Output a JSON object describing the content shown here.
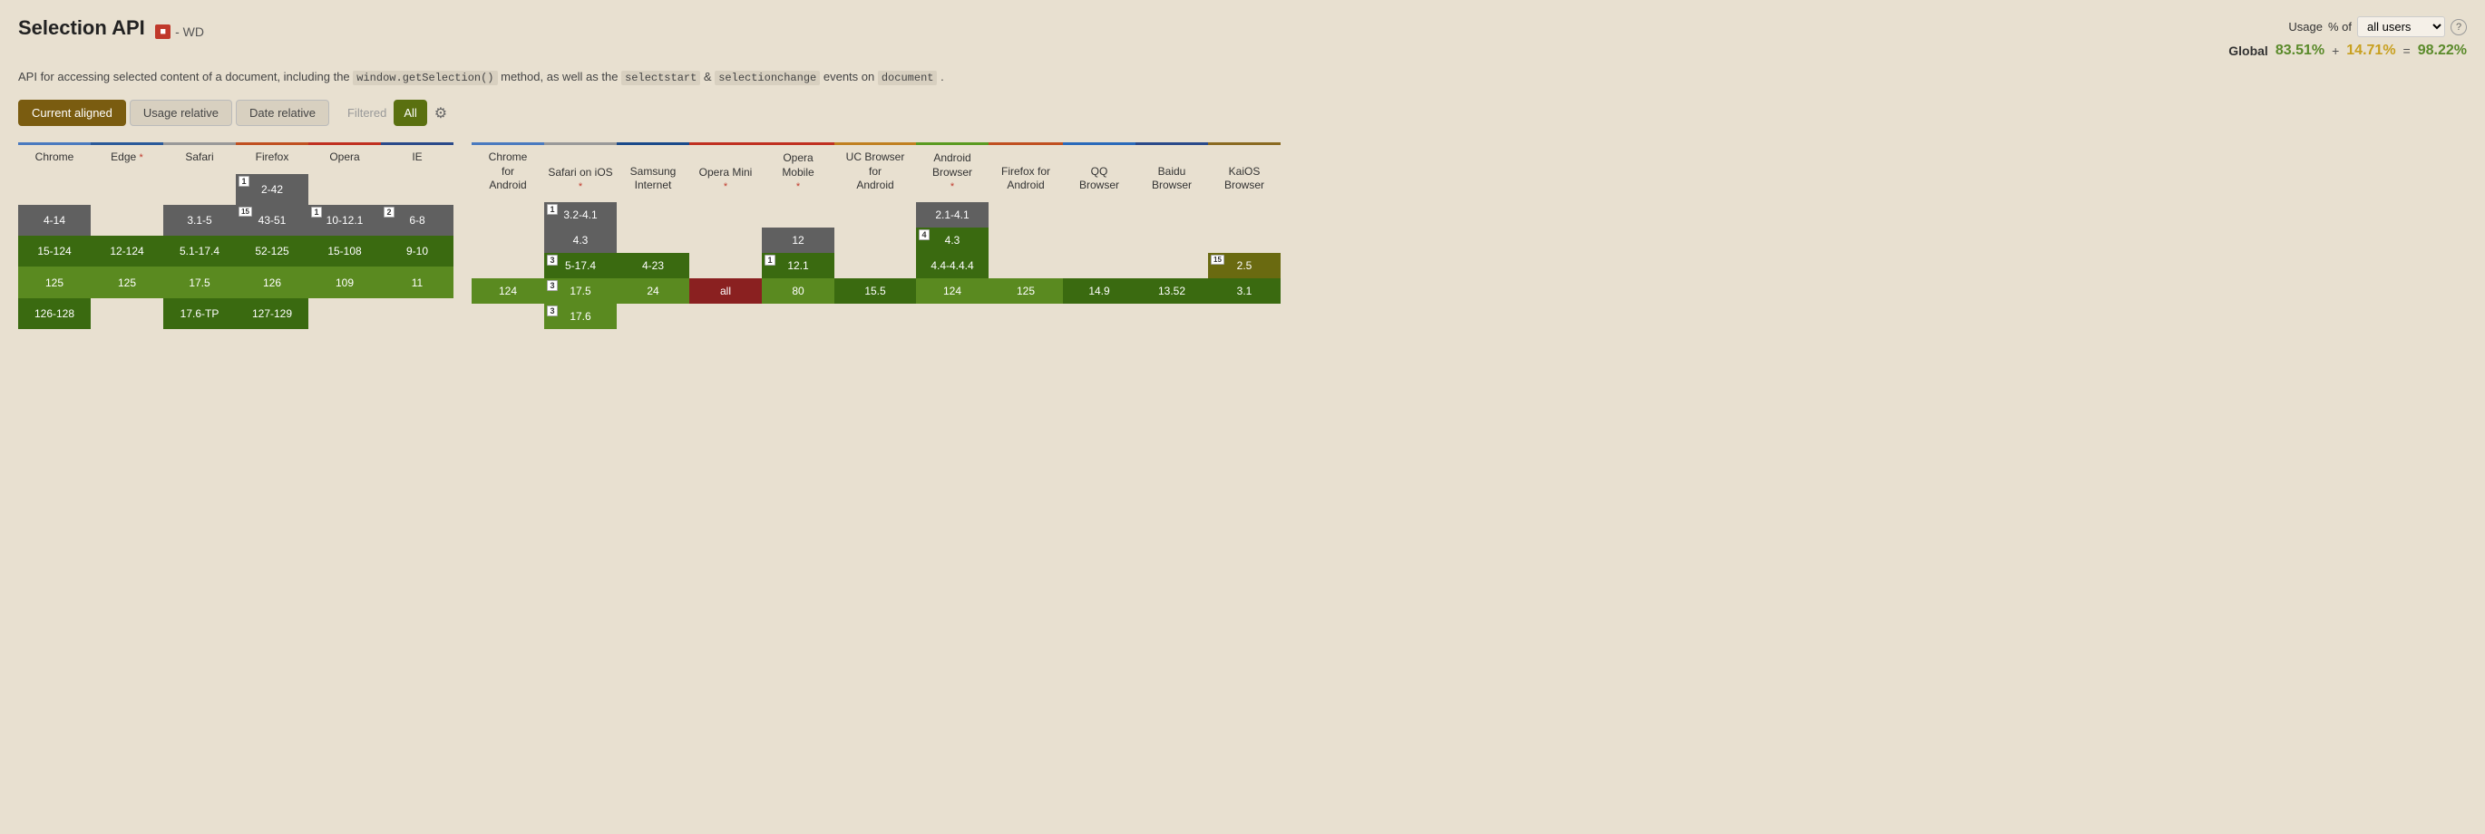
{
  "page": {
    "title": "Selection API",
    "badge": "WD",
    "description_parts": [
      "API for accessing selected content of a document, including the",
      "window.getSelection()",
      "method, as well as the",
      "selectstart",
      "&",
      "selectionchange",
      "events on",
      "document",
      "."
    ]
  },
  "usage": {
    "label": "Usage",
    "select_label": "% of",
    "select_value": "all users",
    "help_label": "?",
    "global_label": "Global",
    "green_pct": "83.51%",
    "plus": "+",
    "partial_pct": "14.71%",
    "eq": "=",
    "total_pct": "98.22%"
  },
  "tabs": {
    "current_aligned": "Current aligned",
    "usage_relative": "Usage relative",
    "date_relative": "Date relative",
    "filtered": "Filtered",
    "all": "All"
  },
  "desktop_browsers": [
    {
      "name": "Chrome",
      "divider_color": "#4a7abf"
    },
    {
      "name": "Edge",
      "asterisk": true,
      "divider_color": "#2a5a9a"
    },
    {
      "name": "Safari",
      "divider_color": "#888"
    },
    {
      "name": "Firefox",
      "divider_color": "#c05020"
    },
    {
      "name": "Opera",
      "divider_color": "#c03020"
    },
    {
      "name": "IE",
      "divider_color": "#2a4a8a"
    }
  ],
  "mobile_browsers": [
    {
      "name": "Chrome for Android",
      "divider_color": "#4a7abf",
      "multiline": true
    },
    {
      "name": "Safari on iOS",
      "asterisk": true,
      "divider_color": "#888",
      "multiline": true
    },
    {
      "name": "Samsung Internet",
      "divider_color": "#1a4a8a",
      "multiline": true
    },
    {
      "name": "Opera Mini",
      "asterisk": true,
      "divider_color": "#c03020",
      "multiline": true
    },
    {
      "name": "Opera Mobile",
      "asterisk": true,
      "divider_color": "#c03020",
      "multiline": true
    },
    {
      "name": "UC Browser for Android",
      "divider_color": "#c08020",
      "multiline": true
    },
    {
      "name": "Android Browser",
      "asterisk": true,
      "divider_color": "#5a9a20",
      "multiline": true
    },
    {
      "name": "Firefox for Android",
      "divider_color": "#c05020",
      "multiline": true
    },
    {
      "name": "QQ Browser",
      "divider_color": "#2a6aba",
      "multiline": true
    },
    {
      "name": "Baidu Browser",
      "divider_color": "#2a4a8a",
      "multiline": true
    },
    {
      "name": "KaiOS Browser",
      "divider_color": "#8a6a20",
      "multiline": true
    }
  ],
  "desktop_rows": [
    [
      {
        "text": "",
        "class": "cell-empty"
      },
      {
        "text": "",
        "class": "cell-empty"
      },
      {
        "text": "",
        "class": "cell-empty"
      },
      {
        "text": "2-42",
        "class": "cell-gray",
        "badge": "1"
      },
      {
        "text": "",
        "class": "cell-empty"
      },
      {
        "text": "",
        "class": "cell-empty"
      }
    ],
    [
      {
        "text": "4-14",
        "class": "cell-gray"
      },
      {
        "text": "",
        "class": "cell-empty"
      },
      {
        "text": "3.1-5",
        "class": "cell-gray"
      },
      {
        "text": "43-51",
        "class": "cell-gray",
        "badge": "15"
      },
      {
        "text": "10-12.1",
        "class": "cell-gray",
        "badge": "1"
      },
      {
        "text": "6-8",
        "class": "cell-gray",
        "badge": "2"
      }
    ],
    [
      {
        "text": "15-124",
        "class": "cell-green-dark"
      },
      {
        "text": "12-124",
        "class": "cell-green-dark"
      },
      {
        "text": "5.1-17.4",
        "class": "cell-green-dark"
      },
      {
        "text": "52-125",
        "class": "cell-green-dark"
      },
      {
        "text": "15-108",
        "class": "cell-green-dark"
      },
      {
        "text": "9-10",
        "class": "cell-green-dark"
      }
    ],
    [
      {
        "text": "125",
        "class": "cell-green"
      },
      {
        "text": "125",
        "class": "cell-green"
      },
      {
        "text": "17.5",
        "class": "cell-green"
      },
      {
        "text": "126",
        "class": "cell-green"
      },
      {
        "text": "109",
        "class": "cell-green"
      },
      {
        "text": "11",
        "class": "cell-green"
      }
    ],
    [
      {
        "text": "126-128",
        "class": "cell-green-dark"
      },
      {
        "text": "",
        "class": "cell-empty"
      },
      {
        "text": "17.6-TP",
        "class": "cell-green-dark"
      },
      {
        "text": "127-129",
        "class": "cell-green-dark"
      },
      {
        "text": "",
        "class": "cell-empty"
      },
      {
        "text": "",
        "class": "cell-empty"
      }
    ]
  ],
  "mobile_rows": [
    [
      {
        "text": "",
        "class": "cell-empty"
      },
      {
        "text": "3.2-4.1",
        "class": "cell-gray",
        "badge": "1"
      },
      {
        "text": "",
        "class": "cell-empty"
      },
      {
        "text": "",
        "class": "cell-empty"
      },
      {
        "text": "",
        "class": "cell-empty"
      },
      {
        "text": "",
        "class": "cell-empty"
      },
      {
        "text": "2.1-4.1",
        "class": "cell-gray"
      },
      {
        "text": "",
        "class": "cell-empty"
      },
      {
        "text": "",
        "class": "cell-empty"
      },
      {
        "text": "",
        "class": "cell-empty"
      },
      {
        "text": "",
        "class": "cell-empty"
      }
    ],
    [
      {
        "text": "",
        "class": "cell-empty"
      },
      {
        "text": "4.3",
        "class": "cell-gray"
      },
      {
        "text": "",
        "class": "cell-empty"
      },
      {
        "text": "",
        "class": "cell-empty"
      },
      {
        "text": "12",
        "class": "cell-gray"
      },
      {
        "text": "",
        "class": "cell-empty"
      },
      {
        "text": "4.3",
        "class": "cell-green-dark",
        "badge": "4"
      },
      {
        "text": "",
        "class": "cell-empty"
      },
      {
        "text": "",
        "class": "cell-empty"
      },
      {
        "text": "",
        "class": "cell-empty"
      },
      {
        "text": "",
        "class": "cell-empty"
      }
    ],
    [
      {
        "text": "",
        "class": "cell-empty"
      },
      {
        "text": "5-17.4",
        "class": "cell-green-dark",
        "badge": "3"
      },
      {
        "text": "4-23",
        "class": "cell-green-dark"
      },
      {
        "text": "",
        "class": "cell-empty"
      },
      {
        "text": "12.1",
        "class": "cell-green-dark",
        "badge": "1"
      },
      {
        "text": "",
        "class": "cell-empty"
      },
      {
        "text": "4.4-4.4.4",
        "class": "cell-green-dark"
      },
      {
        "text": "",
        "class": "cell-empty"
      },
      {
        "text": "",
        "class": "cell-empty"
      },
      {
        "text": "",
        "class": "cell-empty"
      },
      {
        "text": "2.5",
        "class": "cell-olive",
        "badge": "15"
      }
    ],
    [
      {
        "text": "124",
        "class": "cell-green"
      },
      {
        "text": "17.5",
        "class": "cell-green",
        "badge": "3"
      },
      {
        "text": "24",
        "class": "cell-green"
      },
      {
        "text": "all",
        "class": "cell-red"
      },
      {
        "text": "80",
        "class": "cell-green"
      },
      {
        "text": "15.5",
        "class": "cell-green-dark"
      },
      {
        "text": "124",
        "class": "cell-green"
      },
      {
        "text": "125",
        "class": "cell-green"
      },
      {
        "text": "14.9",
        "class": "cell-green-dark"
      },
      {
        "text": "13.52",
        "class": "cell-green-dark"
      },
      {
        "text": "3.1",
        "class": "cell-green-dark"
      }
    ],
    [
      {
        "text": "",
        "class": "cell-empty"
      },
      {
        "text": "17.6",
        "class": "cell-green",
        "badge": "3"
      },
      {
        "text": "",
        "class": "cell-empty"
      },
      {
        "text": "",
        "class": "cell-empty"
      },
      {
        "text": "",
        "class": "cell-empty"
      },
      {
        "text": "",
        "class": "cell-empty"
      },
      {
        "text": "",
        "class": "cell-empty"
      },
      {
        "text": "",
        "class": "cell-empty"
      },
      {
        "text": "",
        "class": "cell-empty"
      },
      {
        "text": "",
        "class": "cell-empty"
      },
      {
        "text": "",
        "class": "cell-empty"
      }
    ]
  ],
  "divider_colors": {
    "chrome": "#4a7abf",
    "edge": "#2a5a9a",
    "safari": "#999",
    "firefox": "#c05020",
    "opera": "#c03020",
    "ie": "#2a4a8a",
    "chrome_android": "#4a7abf",
    "safari_ios": "#999",
    "samsung": "#1a4a8a",
    "opera_mini": "#c03020",
    "opera_mobile": "#c03020",
    "uc_browser": "#c08020",
    "android_browser": "#5a9a20",
    "firefox_android": "#c05020",
    "qq": "#2a6aba",
    "baidu": "#2a4a8a",
    "kaios": "#8a6a20"
  }
}
